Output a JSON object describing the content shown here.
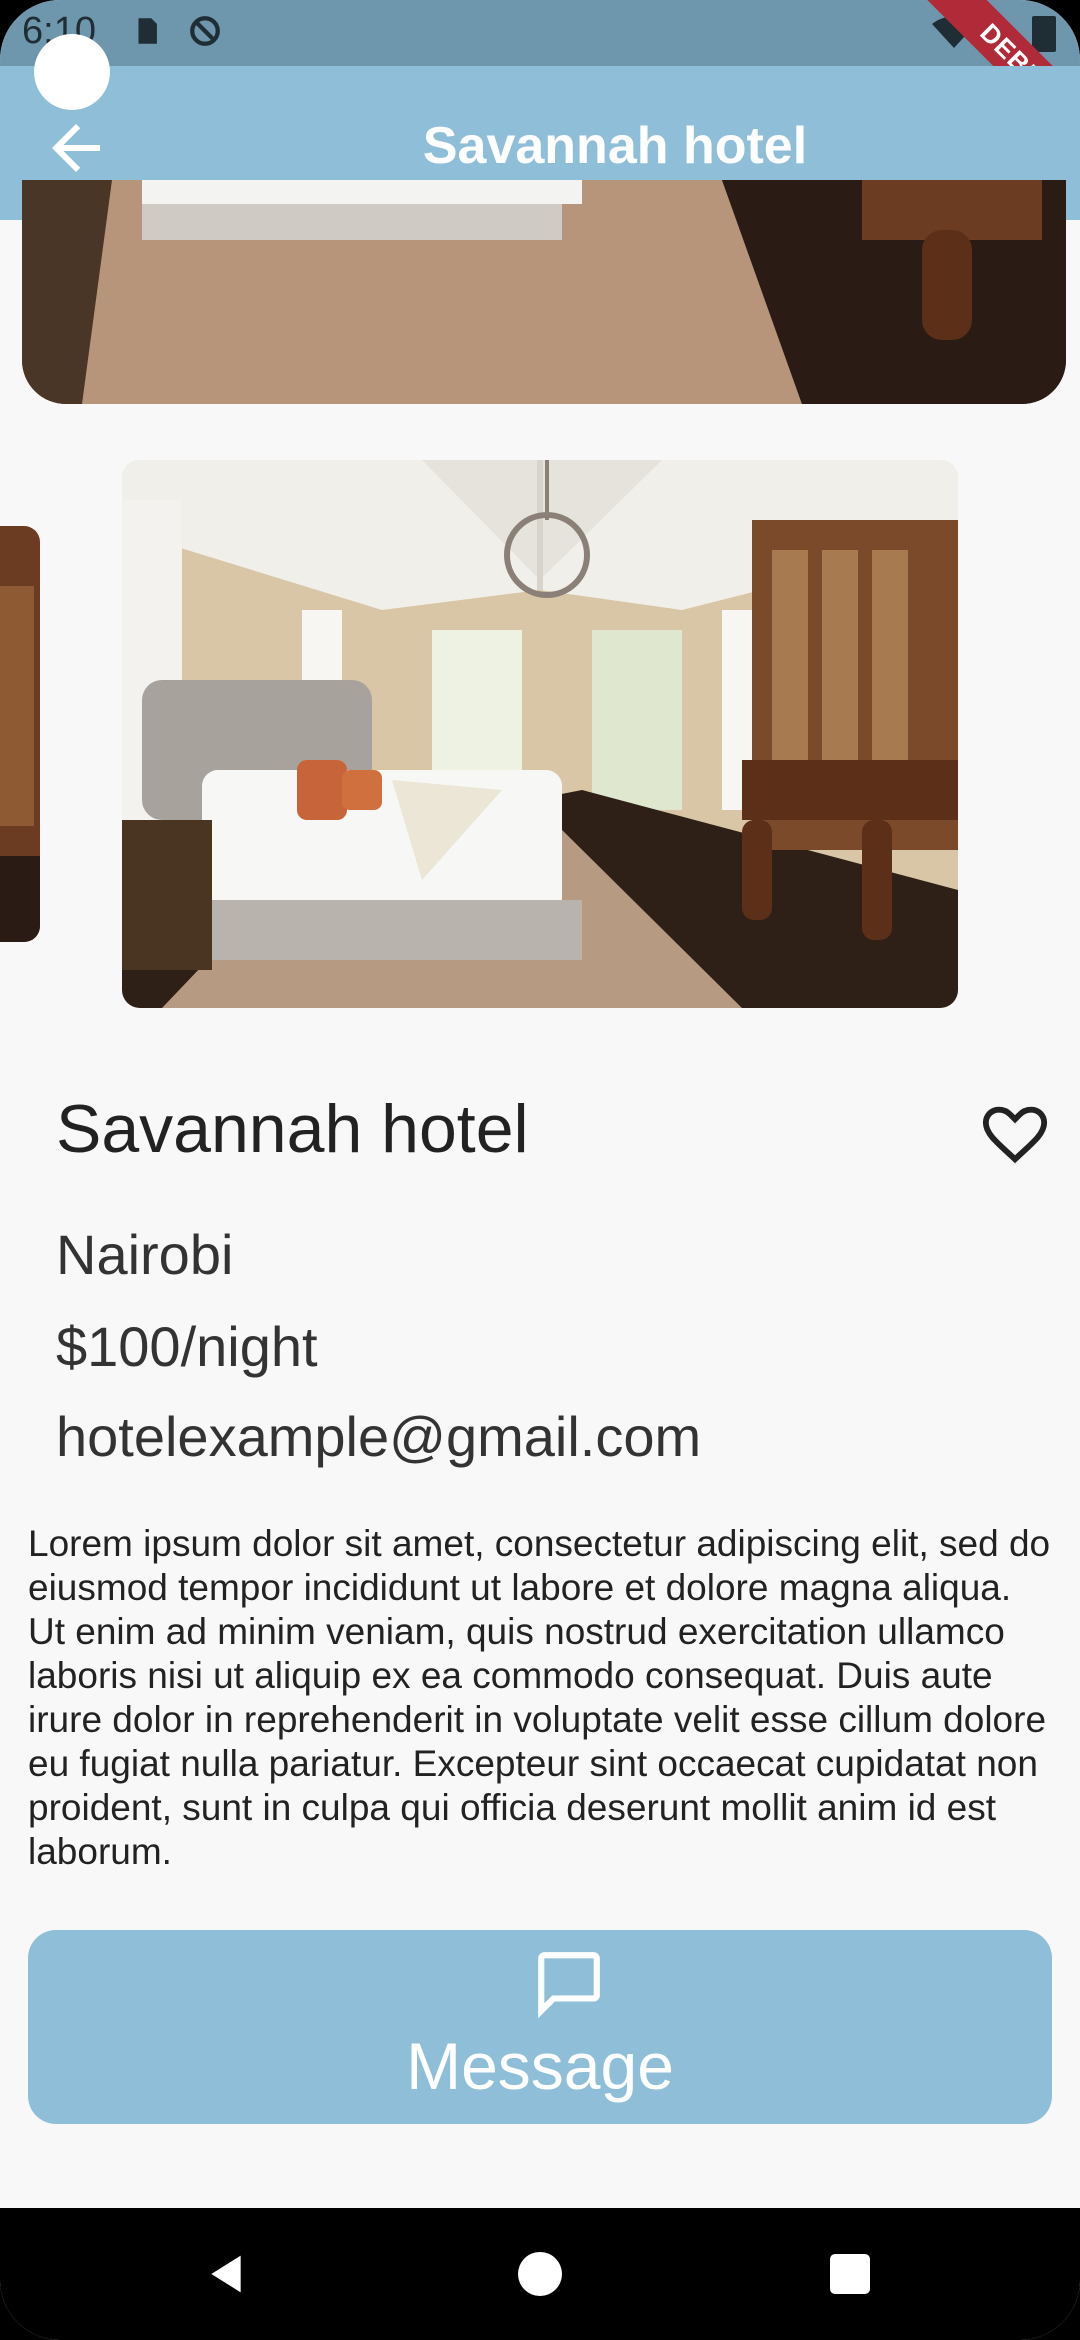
{
  "status_bar": {
    "time": "6:10",
    "debug_label": "DEBUG"
  },
  "app_bar": {
    "title": "Savannah hotel",
    "back_icon": "arrow-left-icon"
  },
  "gallery": {
    "photos": [
      "bedroom-photo",
      "bedroom-photo",
      "bedroom-photo"
    ]
  },
  "hotel": {
    "name": "Savannah hotel",
    "city": "Nairobi",
    "price": "$100/night",
    "email": "hotelexample@gmail.com",
    "favorite_icon": "heart-outline-icon",
    "description": "Lorem ipsum dolor sit amet, consectetur adipiscing elit, sed do eiusmod tempor incididunt ut labore et dolore magna aliqua. Ut enim ad minim veniam, quis nostrud exercitation ullamco laboris nisi ut aliquip ex ea commodo consequat. Duis aute irure dolor in reprehenderit in voluptate velit esse cillum dolore eu fugiat nulla pariatur. Excepteur sint occaecat cupidatat non proident, sunt in culpa qui officia deserunt mollit anim id est laborum."
  },
  "message_button": {
    "label": "Message",
    "icon": "chat-bubble-icon"
  },
  "colors": {
    "accent": "#8fbfd8",
    "status_bar": "#6e97ad",
    "background": "#f8f8f8"
  }
}
